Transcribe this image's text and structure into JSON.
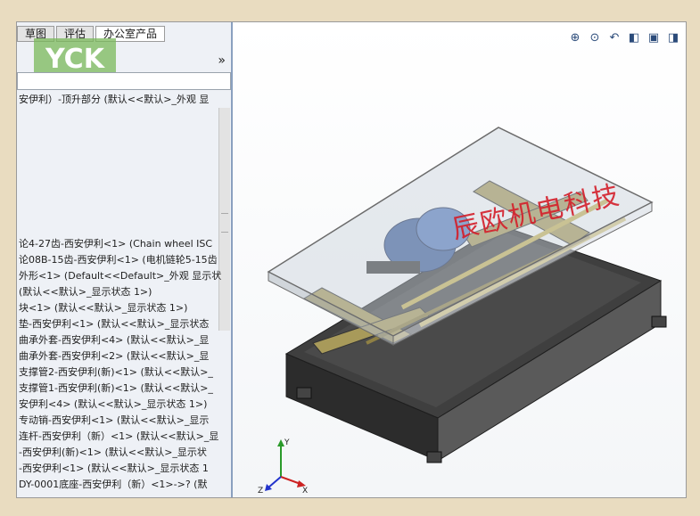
{
  "tabs": [
    "草图",
    "评估",
    "办公室产品"
  ],
  "watermark": "辰欧机电科技",
  "tree": {
    "title": "安伊利）-顶升部分 (默认<<默认>_外观 显",
    "rows": [
      "论4-27齿-西安伊利<1> (Chain wheel ISC",
      "论08B-15齿-西安伊利<1> (电机链轮5-15齿",
      "外形<1> (Default<<Default>_外观 显示状",
      "(默认<<默认>_显示状态 1>)",
      "块<1> (默认<<默认>_显示状态 1>)",
      "垫-西安伊利<1> (默认<<默认>_显示状态",
      "曲承外套-西安伊利<4> (默认<<默认>_显",
      "曲承外套-西安伊利<2> (默认<<默认>_显",
      "支撑管2-西安伊利(新)<1> (默认<<默认>_",
      "支撑管1-西安伊利(新)<1> (默认<<默认>_",
      "安伊利<4> (默认<<默认>_显示状态 1>)",
      "专动销-西安伊利<1> (默认<<默认>_显示",
      "连杆-西安伊利（新）<1> (默认<<默认>_显",
      "-西安伊利(新)<1> (默认<<默认>_显示状",
      "-西安伊利<1> (默认<<默认>_显示状态 1",
      "DY-0001底座-西安伊利（新）<1>->? (默"
    ]
  },
  "toolbar": [
    "zoom-fit-icon",
    "zoom-area-icon",
    "previous-view-icon",
    "section-view-icon",
    "view-orientation-icon",
    "display-style-icon"
  ],
  "triad": {
    "x": "X",
    "y": "Y",
    "z": "Z"
  }
}
